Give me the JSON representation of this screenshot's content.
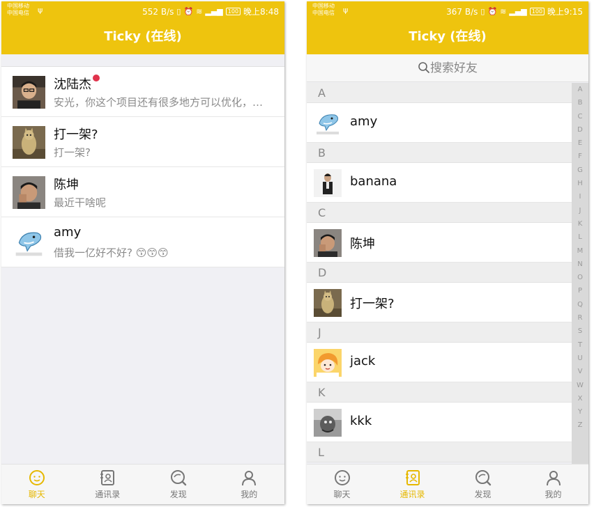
{
  "left": {
    "status": {
      "carrier1": "中国移动",
      "carrier2": "中国电信",
      "speed": "552 B/s",
      "battery": "100",
      "time": "晚上8:48"
    },
    "title": "Ticky (在线)",
    "chats": [
      {
        "name": "沈陆杰",
        "message": "安光，你这个项目还有很多地方可以优化，…",
        "unread": true,
        "avatar": "person-1"
      },
      {
        "name": "打一架?",
        "message": "打一架?",
        "unread": false,
        "avatar": "cat"
      },
      {
        "name": "陈坤",
        "message": "最近干啥呢",
        "unread": false,
        "avatar": "person-2"
      },
      {
        "name": "amy",
        "message": "借我一亿好不好? 😙😙😙",
        "unread": false,
        "avatar": "dolphin"
      }
    ],
    "tabs": [
      {
        "label": "聊天",
        "icon": "chat-icon",
        "active": true
      },
      {
        "label": "通讯录",
        "icon": "contacts-icon",
        "active": false
      },
      {
        "label": "发现",
        "icon": "discover-icon",
        "active": false
      },
      {
        "label": "我的",
        "icon": "profile-icon",
        "active": false
      }
    ]
  },
  "right": {
    "status": {
      "carrier1": "中国移动",
      "carrier2": "中国电信",
      "speed": "367 B/s",
      "battery": "100",
      "time": "晚上9:15"
    },
    "title": "Ticky (在线)",
    "search_placeholder": "搜索好友",
    "sections": [
      {
        "letter": "A",
        "contacts": [
          {
            "name": "amy",
            "avatar": "dolphin"
          }
        ]
      },
      {
        "letter": "B",
        "contacts": [
          {
            "name": "banana",
            "avatar": "person-3"
          }
        ]
      },
      {
        "letter": "C",
        "contacts": [
          {
            "name": "陈坤",
            "avatar": "person-2"
          }
        ]
      },
      {
        "letter": "D",
        "contacts": [
          {
            "name": "打一架?",
            "avatar": "cat"
          }
        ]
      },
      {
        "letter": "J",
        "contacts": [
          {
            "name": "jack",
            "avatar": "cartoon-girl"
          }
        ]
      },
      {
        "letter": "K",
        "contacts": [
          {
            "name": "kkk",
            "avatar": "bw-photo"
          }
        ]
      },
      {
        "letter": "L",
        "contacts": []
      }
    ],
    "index_letters": [
      "A",
      "B",
      "C",
      "D",
      "E",
      "F",
      "G",
      "H",
      "I",
      "J",
      "K",
      "L",
      "M",
      "N",
      "O",
      "P",
      "Q",
      "R",
      "S",
      "T",
      "U",
      "V",
      "W",
      "X",
      "Y",
      "Z"
    ],
    "tabs": [
      {
        "label": "聊天",
        "icon": "chat-icon",
        "active": false
      },
      {
        "label": "通讯录",
        "icon": "contacts-icon",
        "active": true
      },
      {
        "label": "发现",
        "icon": "discover-icon",
        "active": false
      },
      {
        "label": "我的",
        "icon": "profile-icon",
        "active": false
      }
    ]
  },
  "colors": {
    "brand": "#eec40e",
    "unread": "#e0334c",
    "tab_active": "#e6b800"
  }
}
